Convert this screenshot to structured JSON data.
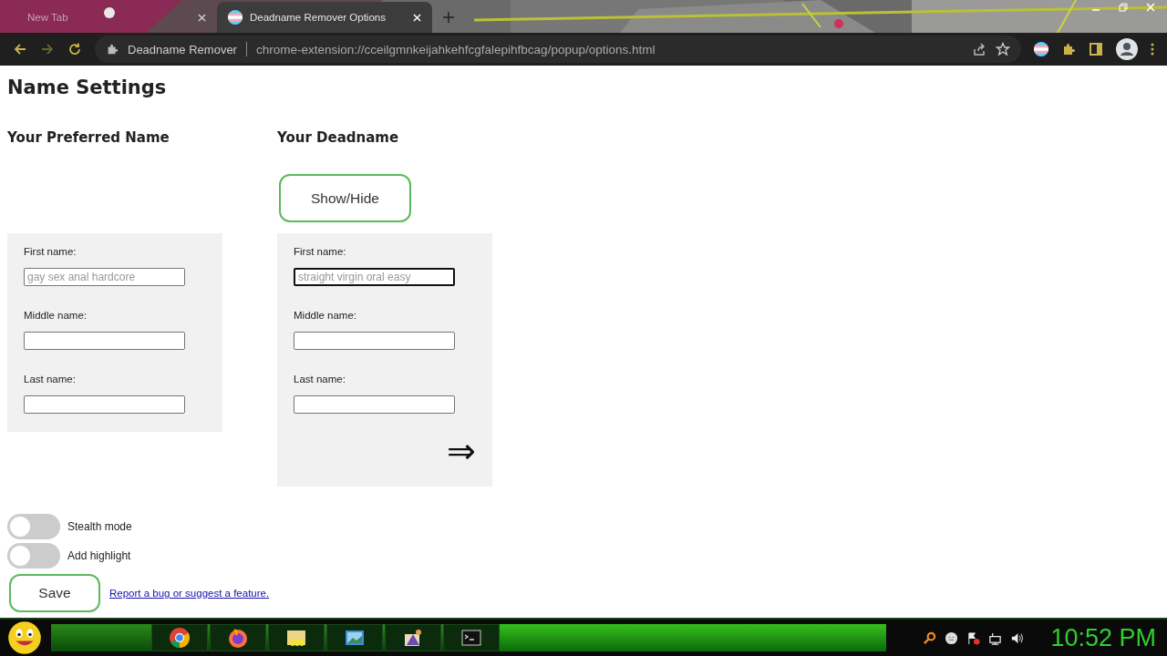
{
  "browser": {
    "tabs": [
      {
        "title": "New Tab",
        "selected": false
      },
      {
        "title": "Deadname Remover Options",
        "selected": true
      }
    ],
    "address": {
      "site": "Deadname Remover",
      "url": "chrome-extension://cceilgmnkeijahkehfcgfalepihfbcag/popup/options.html"
    }
  },
  "page": {
    "title": "Name Settings",
    "columns": [
      {
        "heading": "Your Preferred Name",
        "fields": [
          {
            "label": "First name:",
            "placeholder": "gay sex anal hardcore",
            "focused": false
          },
          {
            "label": "Middle name:",
            "focused": false
          },
          {
            "label": "Last name:",
            "focused": false
          }
        ]
      },
      {
        "heading": "Your Deadname",
        "toggle_button": "Show/Hide",
        "fields": [
          {
            "label": "First name:",
            "placeholder": "straight virgin oral easy",
            "focused": true
          },
          {
            "label": "Middle name:",
            "focused": false
          },
          {
            "label": "Last name:",
            "focused": false
          }
        ],
        "arrow": "⇒"
      }
    ],
    "switches": [
      {
        "label": "Stealth mode",
        "on": false
      },
      {
        "label": "Add highlight",
        "on": false
      }
    ],
    "save_button": "Save",
    "link": "Report a bug or suggest a feature."
  },
  "taskbar": {
    "clock": "10:52 PM"
  }
}
